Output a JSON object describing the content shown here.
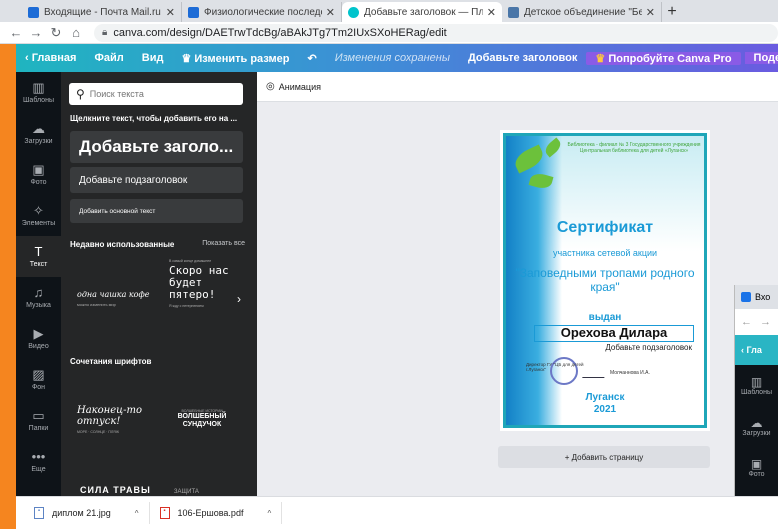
{
  "browser": {
    "tabs": [
      {
        "label": "Входящие - Почта Mail.ru",
        "color": "#1c6bd6"
      },
      {
        "label": "Физиологические последствия",
        "color": "#1c6bd6"
      },
      {
        "label": "Добавьте заголовок — Плакат",
        "color": "#00c4cc"
      },
      {
        "label": "Детское объединение \"Бересте",
        "color": "#4a76a8"
      }
    ],
    "close_glyph": "✕",
    "new_tab_glyph": "+",
    "url": "canva.com/design/DAETrwTdcBg/aBAkJTg7Tm2IUxSXoHERag/edit"
  },
  "canva_bar": {
    "home": "Главная",
    "file": "Файл",
    "view": "Вид",
    "resize": "Изменить размер",
    "saved": "Изменения сохранены",
    "title": "Добавьте заголовок",
    "pro": "Попробуйте Canva Pro",
    "share": "Поделит"
  },
  "rail": [
    {
      "label": "Шаблоны",
      "icon": "▥"
    },
    {
      "label": "Загрузки",
      "icon": "☁"
    },
    {
      "label": "Фото",
      "icon": "▣"
    },
    {
      "label": "Элементы",
      "icon": "✧"
    },
    {
      "label": "Текст",
      "icon": "T"
    },
    {
      "label": "Музыка",
      "icon": "♫"
    },
    {
      "label": "Видео",
      "icon": "▶"
    },
    {
      "label": "Фон",
      "icon": "▨"
    },
    {
      "label": "Папки",
      "icon": "▭"
    },
    {
      "label": "Еще",
      "icon": "•••"
    }
  ],
  "panel": {
    "search_placeholder": "Поиск текста",
    "hint": "Щелкните текст, чтобы добавить его на ...",
    "heading": "Добавьте заголо...",
    "subheading": "Добавьте подзаголовок",
    "body": "Добавить основной текст",
    "recent_title": "Недавно использованные",
    "show_all": "Показать все",
    "font1": {
      "big": "одна чашка кофе",
      "small": "можно изменить мир"
    },
    "font2": {
      "tiny": "В самый конце домашнее",
      "big": "Скоро нас будет пятеро!",
      "small": "Я жду с нетерпением"
    },
    "combos_title": "Сочетания шрифтов",
    "font3": {
      "big": "Наконец-то отпуск!",
      "small": "МОРЕ · СОЛНЦЕ · ПЛЯЖ"
    },
    "font4": {
      "tiny": "ВОЛШЕБНЫЕ ИСТОРИИ",
      "big": "ВОЛШЕБНЫЙ СУНДУЧОК"
    },
    "font5": {
      "a": "СИЛА ТРАВЫ",
      "b": "ЗАЩИТА"
    }
  },
  "toolbar": {
    "animation": "Анимация"
  },
  "certificate": {
    "org": "Библиотека - филиал № 3 Государственного учреждения Центральная библиотека для детей «Луганск»",
    "title": "Сертификат",
    "subtitle": "участника сетевой акции",
    "event": "\"Заповедными тропами родного края\"",
    "issued": "выдан",
    "name": "Орехова Дилара",
    "placeholder": "Добавьте подзаголовок",
    "director": "Директор ГУ \"ЦБ для детей г.Луганск\"",
    "signer": "Молчаннова И.А.",
    "city": "Луганск",
    "year": "2021"
  },
  "add_page": "+ Добавить страницу",
  "second_window": {
    "tab": "Вхо",
    "home": "Гла",
    "rail": [
      "Шаблоны",
      "Загрузки",
      "Фото"
    ]
  },
  "downloads": [
    {
      "name": "диплом 21.jpg"
    },
    {
      "name": "106-Ершова.pdf"
    }
  ]
}
